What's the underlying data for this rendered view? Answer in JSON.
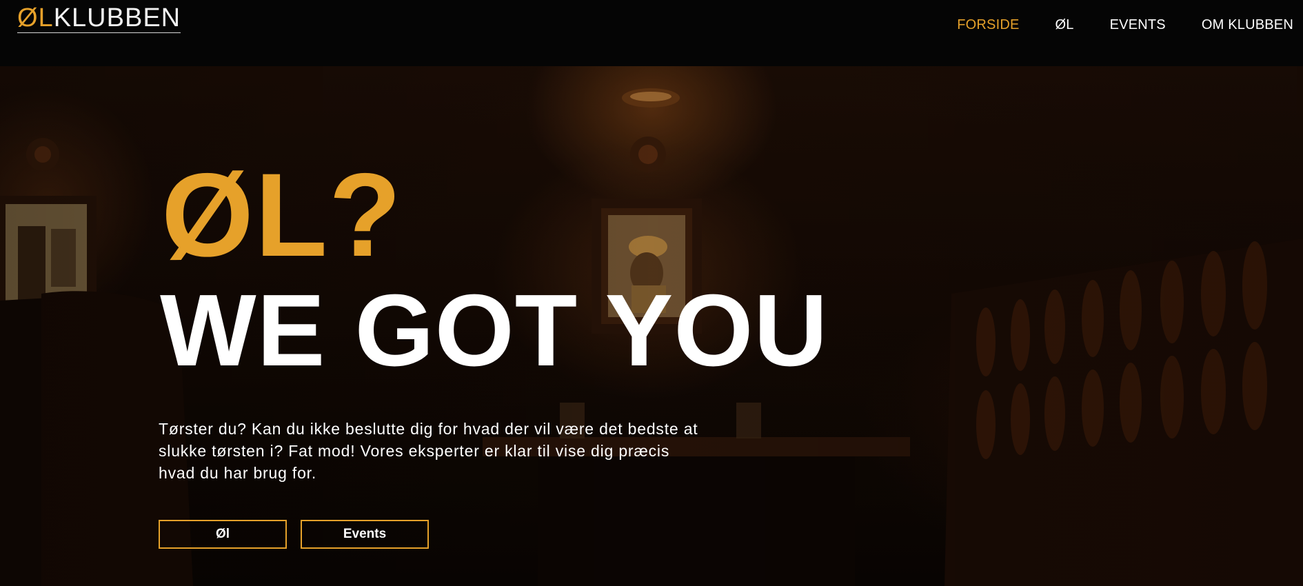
{
  "header": {
    "logo": {
      "accent": "ØL",
      "rest": "KLUBBEN"
    },
    "nav": [
      {
        "label": "FORSIDE",
        "active": true
      },
      {
        "label": "ØL",
        "active": false
      },
      {
        "label": "EVENTS",
        "active": false
      },
      {
        "label": "OM KLUBBEN",
        "active": false
      }
    ]
  },
  "hero": {
    "headline_1": "ØL?",
    "headline_2": "WE GOT YOU",
    "intro": "Tørster du? Kan du ikke beslutte dig for hvad der vil være det bedste at slukke tørsten i? Fat mod! Vores eksperter er klar til vise dig præcis hvad du har brug for.",
    "buttons": [
      {
        "label": "Øl"
      },
      {
        "label": "Events"
      }
    ]
  },
  "colors": {
    "accent": "#e6a12a",
    "header_bg": "#050505",
    "text": "#ffffff"
  }
}
